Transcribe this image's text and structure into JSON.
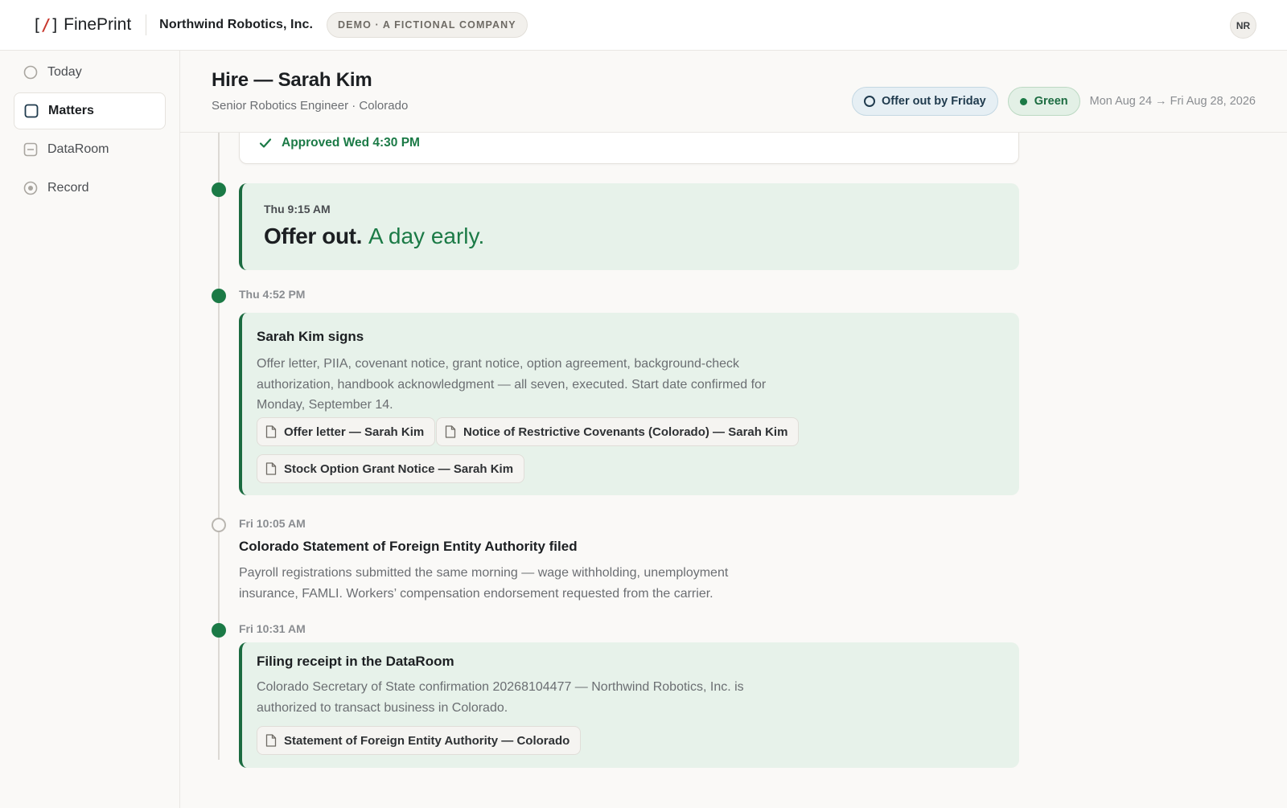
{
  "app": {
    "brand_mark": "[/]",
    "brand_name": "FinePrint",
    "company": "Northwind Robotics, Inc.",
    "demo_badge": "DEMO · A FICTIONAL COMPANY",
    "avatar_initials": "NR"
  },
  "sidebar": {
    "items": [
      {
        "label": "Today",
        "icon": "circle-icon",
        "active": false
      },
      {
        "label": "Matters",
        "icon": "square-icon",
        "active": true
      },
      {
        "label": "DataRoom",
        "icon": "dataroom-icon",
        "active": false
      },
      {
        "label": "Record",
        "icon": "record-icon",
        "active": false
      }
    ]
  },
  "header": {
    "title": "Hire — Sarah Kim",
    "subtitle": "Senior Robotics Engineer · Colorado",
    "goal_pill": "Offer out by Friday",
    "status_pill": "Green",
    "date_range": "Mon Aug 24 → Fri Aug 28, 2026",
    "colors": {
      "status_green": "#1b7a46",
      "goal_blue": "#1f3a4d"
    }
  },
  "timeline": {
    "approved_note": "Approved Wed 4:30 PM",
    "offer": {
      "time": "Thu 9:15 AM",
      "title": "Offer out.",
      "subtitle": "A day early."
    },
    "events": [
      {
        "time": "Thu 4:52 PM",
        "title": "Sarah Kim signs",
        "body": "Offer letter, PIIA, covenant notice, grant notice, option agreement, background-check authorization, handbook acknowledgment — all seven, executed. Start date confirmed for Monday, September 14.",
        "documents": [
          "Offer letter — Sarah Kim",
          "Notice of Restrictive Covenants (Colorado) — Sarah Kim",
          "Stock Option Grant Notice — Sarah Kim"
        ]
      },
      {
        "time": "Fri 10:05 AM",
        "title": "Colorado Statement of Foreign Entity Authority filed",
        "body": "Payroll registrations submitted the same morning — wage withholding, unemployment insurance, FAMLI. Workers’ compensation endorsement requested from the carrier."
      },
      {
        "time": "Fri 10:31 AM",
        "title": "Filing receipt in the DataRoom",
        "body": "Colorado Secretary of State confirmation 20268104477 — Northwind Robotics, Inc. is authorized to transact business in Colorado.",
        "documents": [
          "Statement of Foreign Entity Authority — Colorado"
        ]
      }
    ]
  }
}
